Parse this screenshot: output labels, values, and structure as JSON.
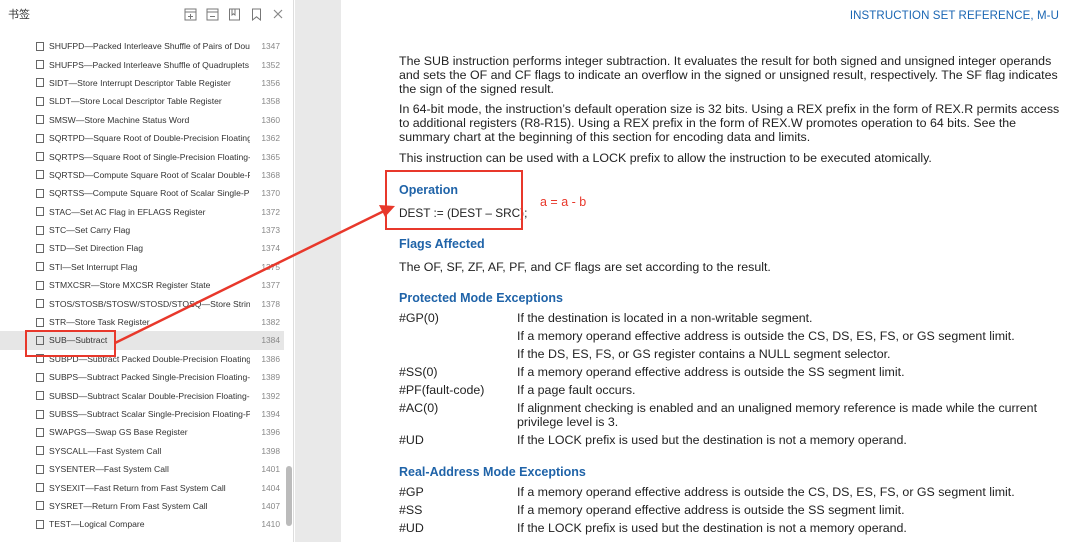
{
  "sidebar": {
    "title": "书签",
    "tools": [
      "expand-all-icon",
      "collapse-all-icon",
      "bookmark-add-icon",
      "bookmark-icon",
      "close-icon"
    ],
    "items": [
      {
        "label": "SHUFPD—Packed Interleave Shuffle of Pairs of Doubl...",
        "page": "1347"
      },
      {
        "label": "SHUFPS—Packed Interleave Shuffle of Quadruplets o...",
        "page": "1352"
      },
      {
        "label": "SIDT—Store Interrupt Descriptor Table Register",
        "page": "1356"
      },
      {
        "label": "SLDT—Store Local Descriptor Table Register",
        "page": "1358"
      },
      {
        "label": "SMSW—Store Machine Status Word",
        "page": "1360"
      },
      {
        "label": "SQRTPD—Square Root of Double-Precision Floating-...",
        "page": "1362"
      },
      {
        "label": "SQRTPS—Square Root of Single-Precision Floating-P...",
        "page": "1365"
      },
      {
        "label": "SQRTSD—Compute Square Root of Scalar Double-Pr...",
        "page": "1368"
      },
      {
        "label": "SQRTSS—Compute Square Root of Scalar Single-Pre...",
        "page": "1370"
      },
      {
        "label": "STAC—Set AC Flag in EFLAGS Register",
        "page": "1372"
      },
      {
        "label": "STC—Set Carry Flag",
        "page": "1373"
      },
      {
        "label": "STD—Set Direction Flag",
        "page": "1374"
      },
      {
        "label": "STI—Set Interrupt Flag",
        "page": "1375"
      },
      {
        "label": "STMXCSR—Store MXCSR Register State",
        "page": "1377"
      },
      {
        "label": "STOS/STOSB/STOSW/STOSD/STOSQ—Store String",
        "page": "1378"
      },
      {
        "label": "STR—Store Task Register",
        "page": "1382"
      },
      {
        "label": "SUB—Subtract",
        "page": "1384",
        "selected": true
      },
      {
        "label": "SUBPD—Subtract Packed Double-Precision Floating-...",
        "page": "1386"
      },
      {
        "label": "SUBPS—Subtract Packed Single-Precision Floating-P...",
        "page": "1389"
      },
      {
        "label": "SUBSD—Subtract Scalar Double-Precision Floating-P...",
        "page": "1392"
      },
      {
        "label": "SUBSS—Subtract Scalar Single-Precision Floating-Poi...",
        "page": "1394"
      },
      {
        "label": "SWAPGS—Swap GS Base Register",
        "page": "1396"
      },
      {
        "label": "SYSCALL—Fast System Call",
        "page": "1398"
      },
      {
        "label": "SYSENTER—Fast System Call",
        "page": "1401"
      },
      {
        "label": "SYSEXIT—Fast Return from Fast System Call",
        "page": "1404"
      },
      {
        "label": "SYSRET—Return From Fast System Call",
        "page": "1407"
      },
      {
        "label": "TEST—Logical Compare",
        "page": "1410"
      }
    ]
  },
  "document": {
    "running_header": "INSTRUCTION SET REFERENCE, M-U",
    "paragraphs": [
      "The SUB instruction performs integer subtraction. It evaluates the result for both signed and unsigned integer operands and sets the OF and CF flags to indicate an overflow in the signed or unsigned result, respectively. The SF flag indicates the sign of the signed result.",
      "In 64-bit mode, the instruction’s default operation size is 32 bits. Using a REX prefix in the form of REX.R permits access to additional registers (R8-R15). Using a REX prefix in the form of REX.W promotes operation to 64 bits. See the summary chart at the beginning of this section for encoding data and limits.",
      "This instruction can be used with a LOCK prefix to allow the instruction to be executed atomically."
    ],
    "operation": {
      "heading": "Operation",
      "code": "DEST := (DEST – SRC);"
    },
    "flags": {
      "heading": "Flags Affected",
      "text": "The OF, SF, ZF, AF, PF, and CF flags are set according to the result."
    },
    "protected_mode": {
      "heading": "Protected Mode Exceptions",
      "rows": [
        {
          "code": "#GP(0)",
          "desc": "If the destination is located in a non-writable segment."
        },
        {
          "code": "",
          "desc": "If a memory operand effective address is outside the CS, DS, ES, FS, or GS segment limit."
        },
        {
          "code": "",
          "desc": "If the DS, ES, FS, or GS register contains a NULL segment selector."
        },
        {
          "code": "#SS(0)",
          "desc": "If a memory operand effective address is outside the SS segment limit."
        },
        {
          "code": "#PF(fault-code)",
          "desc": "If a page fault occurs."
        },
        {
          "code": "#AC(0)",
          "desc": "If alignment checking is enabled and an unaligned memory reference is made while the current privilege level is 3."
        },
        {
          "code": "#UD",
          "desc": "If the LOCK prefix is used but the destination is not a memory operand."
        }
      ]
    },
    "real_mode": {
      "heading": "Real-Address Mode Exceptions",
      "rows": [
        {
          "code": "#GP",
          "desc": "If a memory operand effective address is outside the CS, DS, ES, FS, or GS segment limit."
        },
        {
          "code": "#SS",
          "desc": "If a memory operand effective address is outside the SS segment limit."
        },
        {
          "code": "#UD",
          "desc": "If the LOCK prefix is used but the destination is not a memory operand."
        }
      ]
    }
  },
  "annotation": {
    "note": "a = a - b",
    "color": "#e8382b"
  }
}
